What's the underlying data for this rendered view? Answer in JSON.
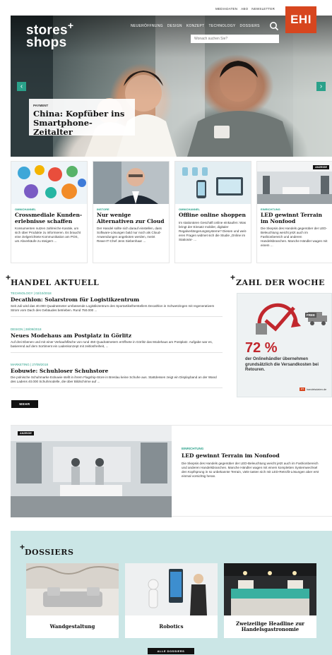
{
  "top_links": [
    "MEDIADATEN",
    "ABO",
    "NEWSLETTER"
  ],
  "ehi_logo": "EHI",
  "logo": {
    "line1": "stores",
    "plus": "+",
    "line2": "shops"
  },
  "nav": [
    "NEUERÖFFNUNG",
    "DESIGN",
    "KONZEPT",
    "TECHNOLOGY",
    "DOSSIERS"
  ],
  "search": {
    "placeholder": "Wonach suchen Sie?"
  },
  "hero": {
    "kicker": "PAYMENT",
    "title": "China: Kopfüber ins Smartphone-Zeitalter",
    "prev": "‹",
    "next": "›"
  },
  "cards": [
    {
      "category": "OMNICHANNEL",
      "title": "Crossmediale Kunden­erlebnisse schaffen",
      "text": "Konsumenten nutzen zahlreiche Kanäle, um sich über Produkte zu informieren. Es braucht eine ziel­gerichtete Kommunikation am POS, um Abverkäufe zu steigern ..."
    },
    {
      "category": "INSTORE",
      "title": "Nur wenige Alternativen zur Cloud",
      "text": "Der Handel sollte sich darauf ein­stellen, dass Software-Lösungen bald nur noch als Cloud-Anwend­ungen angeboten werden, meint Rewe-IT-Chef Jens Siebenhaar ..."
    },
    {
      "category": "OMNICHANNEL",
      "title": "Offline online shoppen",
      "text": "Im stationären Geschäft online einkaufen: Was bringt der Einsatz mobiler, digitaler Regalverlänge­rungssysteme? Diesen und weit­eren Fragen widmet sich die Studie „Online im Stationär- ..."
    },
    {
      "category": "EINRICHTUNG",
      "title": "LED gewinnt Terrain im Nonfood",
      "text": "Die Skepsis des Handels gegen­über der LED-Beleuchtung weicht jetzt auch im Fashionbereich und anderen Handelsbranchen. Man­che Händler wagen mit einem ...",
      "badge": "ANZEIGE"
    }
  ],
  "handel": {
    "title": "HANDEL AKTUELL",
    "plus": "+",
    "items": [
      {
        "meta": "TECHNOLOGY | 02/10/2018",
        "title": "Decathlon: Solarstrom für Logistikzentrum",
        "text": "Seit Juli wird das 40.000 Quadratmeter umfassende Logistikzentrum des Sportartikelherstellers Decathlon in Schwetzingen mit regenerativem Strom vom Dach des Gebäudes betrieben. Rund 750.000 ..."
      },
      {
        "meta": "DESIGN | 28/09/2018",
        "title": "Neues Modehaus am Postplatz in Görlitz",
        "text": "Auf drei Ebenen und mit einer Verkaufsfläche von rund 450 Quadratmetern eröffnete in Görlitz das Mode­haus am Postplatz. Aufgabe war es, basierend auf dem Sortiment ein Ladenkonzept mit zeitlosfreiheit, ..."
      },
      {
        "meta": "MARKETING | 27/09/2018",
        "title": "Eobuwie: Schuhloser Schuhstore",
        "text": "Die polnische Schuhmarke Eobuwie stellt in ihrem Flagship-Store in Breslau keine Schuhe aus. Stattdessen zeigt ein Displayband an der Wand des Ladens 40.000 Schuhmodelle, die über Bildschirme auf ..."
      }
    ],
    "more": "MEHR"
  },
  "zahl": {
    "title": "ZAHL DER WOCHE",
    "plus": "+",
    "free": "FREE",
    "percent": "72 %",
    "text": "der Onlinehändler übernehmen grundsätzlich die Versand­kosten bei Retouren.",
    "source": "handelsdaten.de",
    "source_mark": "EHI"
  },
  "bigad": {
    "badge": "ANZEIGE",
    "category": "EINRICHTUNG",
    "title": "LED gewinnt Terrain im Nonfood",
    "text": "Die Skepsis des Handels gegenüber der LED-Beleuchtung weicht jetzt auch im Fashionbereich und anderen Handelsbranchen. Manche Händler wagen mit einem kompletten Systemwechsel den Kopfsprung in so unbekannte Terrain, viele tasten sich mit LED-Retrofit-Lösungen aber erst einmal vorsichtig heran."
  },
  "dossiers": {
    "title": "DOSSIERS",
    "plus": "+",
    "items": [
      "Wandgestaltung",
      "Robotics",
      "Zweizeilige Headline zur Handelsgastronomie"
    ],
    "all": "ALLE DOSSIERS"
  },
  "colors": {
    "accent": "#2aa18a",
    "ehi": "#d7461f",
    "percent": "#c1272d",
    "dossier_bg": "#cbe6e6"
  }
}
